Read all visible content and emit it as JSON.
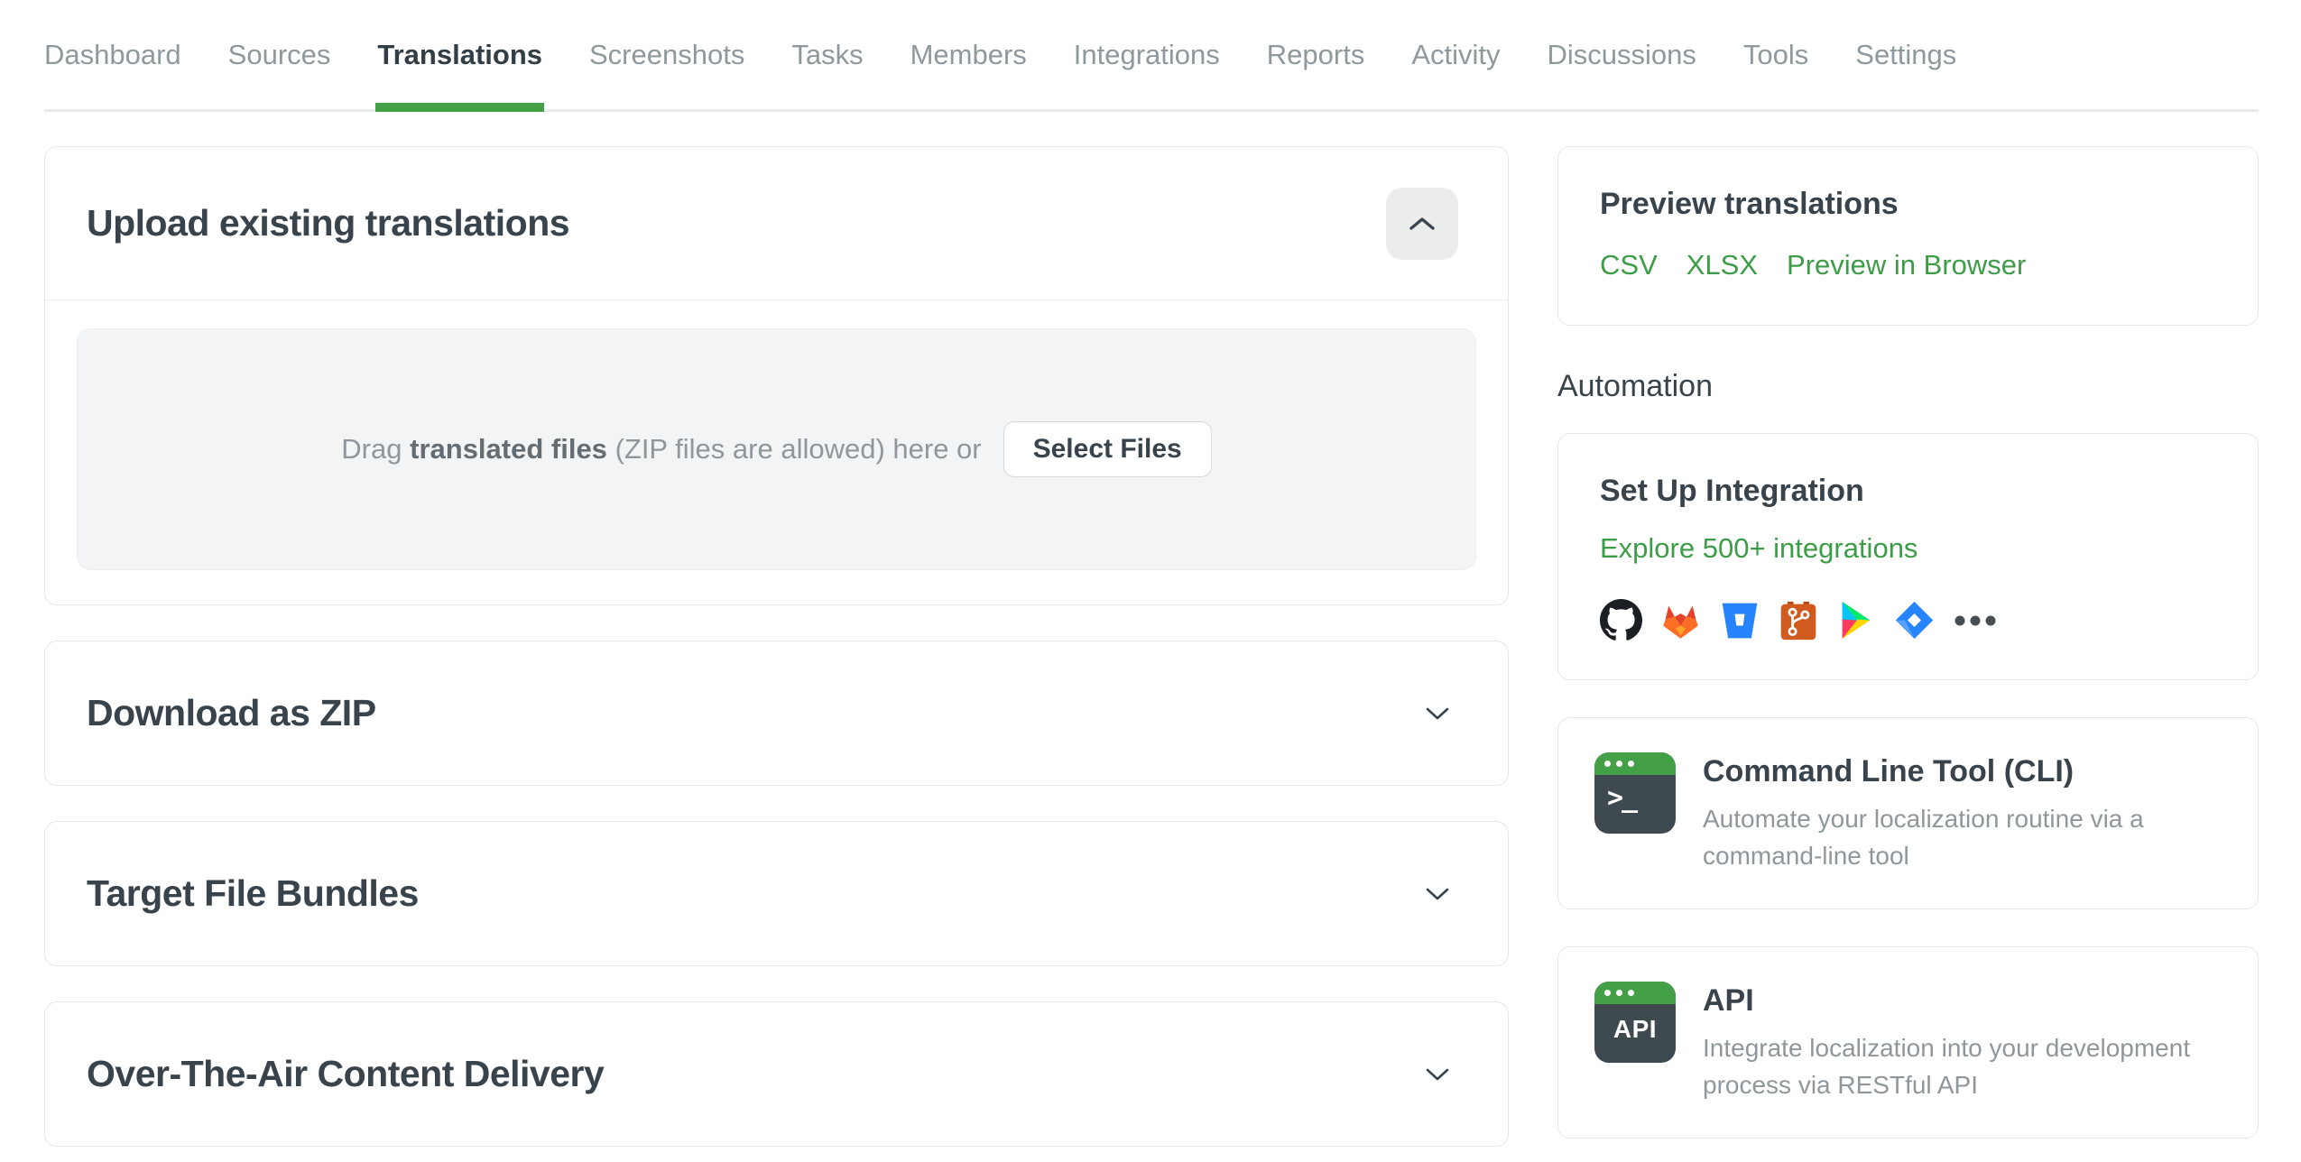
{
  "nav": {
    "tabs": [
      {
        "label": "Dashboard",
        "active": false
      },
      {
        "label": "Sources",
        "active": false
      },
      {
        "label": "Translations",
        "active": true
      },
      {
        "label": "Screenshots",
        "active": false
      },
      {
        "label": "Tasks",
        "active": false
      },
      {
        "label": "Members",
        "active": false
      },
      {
        "label": "Integrations",
        "active": false
      },
      {
        "label": "Reports",
        "active": false
      },
      {
        "label": "Activity",
        "active": false
      },
      {
        "label": "Discussions",
        "active": false
      },
      {
        "label": "Tools",
        "active": false
      },
      {
        "label": "Settings",
        "active": false
      }
    ]
  },
  "main": {
    "upload_card": {
      "title": "Upload existing translations",
      "collapse_icon": "chevron-up-icon",
      "dropzone": {
        "drag_prefix": "Drag",
        "drag_bold": "translated files",
        "drag_suffix": "(ZIP files are allowed) here or",
        "select_button": "Select Files"
      }
    },
    "collapsed_sections": [
      {
        "title": "Download as ZIP",
        "state_icon": "chevron-down-icon"
      },
      {
        "title": "Target File Bundles",
        "state_icon": "chevron-down-icon"
      },
      {
        "title": "Over-The-Air Content Delivery",
        "state_icon": "chevron-down-icon"
      }
    ]
  },
  "sidebar": {
    "preview_card": {
      "title": "Preview translations",
      "links": [
        {
          "label": "CSV"
        },
        {
          "label": "XLSX"
        },
        {
          "label": "Preview in Browser"
        }
      ]
    },
    "automation_heading": "Automation",
    "integration_card": {
      "title": "Set Up Integration",
      "link": "Explore 500+ integrations",
      "icons": [
        "github-icon",
        "gitlab-icon",
        "bitbucket-icon",
        "git-icon",
        "google-play-icon",
        "jira-icon",
        "more-integrations-icon"
      ]
    },
    "cli_card": {
      "icon": "terminal-icon",
      "icon_text": ">_",
      "title": "Command Line Tool (CLI)",
      "description": "Automate your localization routine via a command-line tool"
    },
    "api_card": {
      "icon": "api-icon",
      "icon_text": "API",
      "title": "API",
      "description": "Integrate localization into your development process via RESTful API"
    }
  },
  "colors": {
    "accent_green": "#43a047",
    "link_green": "#3d9c47",
    "heading_text": "#39434b",
    "nav_inactive_text": "#8f999d",
    "muted_text": "#8f979c",
    "card_border": "#e5e6e7",
    "dropzone_bg": "#f3f4f5",
    "collapse_button_bg": "#ebecec",
    "terminal_body": "#3e4a50"
  }
}
